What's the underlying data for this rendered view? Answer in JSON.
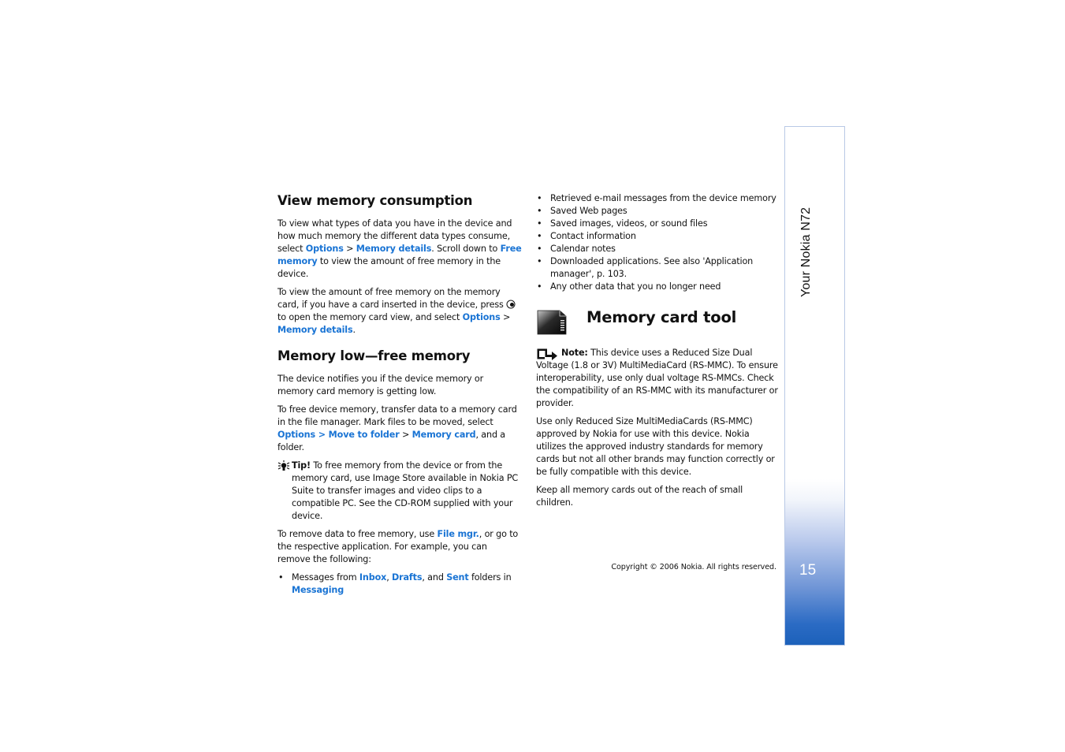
{
  "left_column": {
    "section1": {
      "heading": "View memory consumption",
      "p1": {
        "t1": "To view what types of data you have in the device and how much memory the different data types consume, select ",
        "l1": "Options",
        "t2": " > ",
        "l2": "Memory details",
        "t3": ". Scroll down to ",
        "l3": "Free memory",
        "t4": " to view the amount of free memory in the device."
      },
      "p2": {
        "t1": "To view the amount of free memory on the memory card, if you have a card inserted in the device, press ",
        "icon": "navi-key-icon",
        "t2": " to open the memory card view, and select ",
        "l1": "Options",
        "t3": " > ",
        "l2": "Memory details",
        "t4": "."
      }
    },
    "section2": {
      "heading": "Memory low—free memory",
      "p1": "The device notifies you if the device memory or memory card memory is getting low.",
      "p2": {
        "t1": "To free device memory, transfer data to a memory card in the file manager. Mark files to be moved, select ",
        "l1": "Options > Move to folder",
        "t2": " > ",
        "l2": "Memory card",
        "t3": ", and a folder."
      },
      "tip": {
        "icon": "tip-lightbulb-icon",
        "label": "Tip!",
        "text": " To free memory from the device or from the memory card, use Image Store available in Nokia PC Suite to transfer images and video clips to a compatible PC. See the CD-ROM supplied with your device."
      },
      "p3": {
        "t1": "To remove data to free memory, use ",
        "l1": "File mgr.",
        "t2": ", or go to the respective application. For example, you can remove the following:"
      },
      "bullet1": {
        "t1": "Messages from ",
        "l1": "Inbox",
        "t2": ", ",
        "l2": "Drafts",
        "t3": ", and ",
        "l3": "Sent",
        "t4": " folders in ",
        "l4": "Messaging"
      }
    }
  },
  "right_column": {
    "bullets": [
      "Retrieved e-mail messages from the device memory",
      "Saved Web pages",
      "Saved images, videos, or sound files",
      "Contact information",
      "Calendar notes",
      "Downloaded applications. See also 'Application manager', p. 103.",
      "Any other data that you no longer need"
    ],
    "section3": {
      "icon": "memory-card-icon",
      "heading": "Memory card tool",
      "note": {
        "icon": "note-icon",
        "label": "Note:",
        "text": " This device uses a Reduced Size Dual Voltage (1.8 or 3V) MultiMediaCard (RS-MMC). To ensure interoperability, use only dual voltage RS-MMCs. Check the compatibility of an RS-MMC with its manufacturer or provider."
      },
      "p1": "Use only Reduced Size MultiMediaCards (RS-MMC) approved by Nokia for use with this device. Nokia utilizes the approved industry standards for memory cards but not all other brands may function correctly or be fully compatible with this device.",
      "p2": "Keep all memory cards out of the reach of small children."
    }
  },
  "footer": {
    "copyright": "Copyright © 2006 Nokia. All rights reserved."
  },
  "sidebar": {
    "title": "Your Nokia N72",
    "page_number": "15"
  },
  "colors": {
    "link": "#1a74d4",
    "sidebar_blue": "#1c61ba",
    "sidebar_border": "#b9c9e6"
  }
}
